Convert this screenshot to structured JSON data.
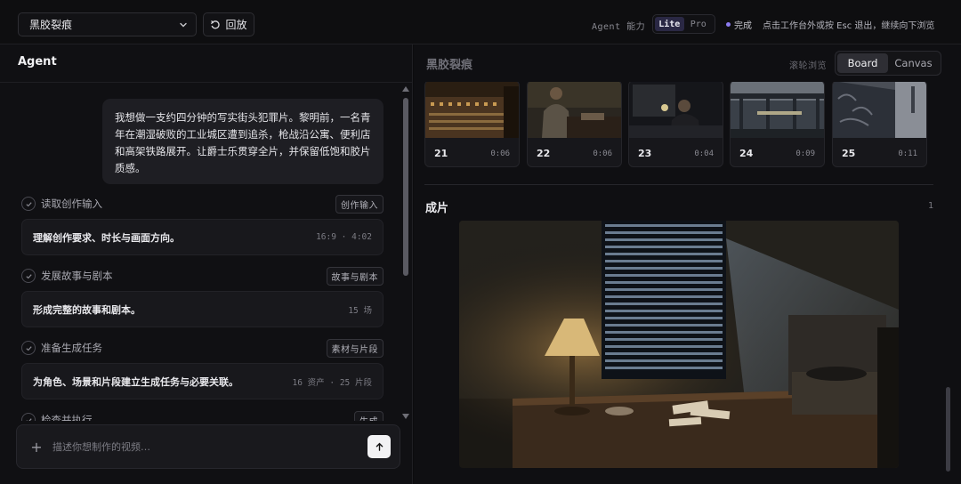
{
  "topbar": {
    "project": "黑胶裂痕",
    "replay_label": "回放",
    "agent_capability_label": "Agent 能力",
    "modes": [
      "Lite",
      "Pro"
    ],
    "active_mode": "Lite",
    "status_text": "完成",
    "hint_text": "点击工作台外或按 Esc 退出，继续向下浏览"
  },
  "agent_panel": {
    "title": "Agent",
    "user_message": "我想做一支约四分钟的写实街头犯罪片。黎明前，一名青年在潮湿破败的工业城区遭到追杀，枪战沿公寓、便利店和高架铁路展开。让爵士乐贯穿全片，并保留低饱和胶片质感。",
    "steps": [
      {
        "title": "读取创作输入",
        "tag": "创作输入",
        "desc": "理解创作要求、时长与画面方向。",
        "meta": "16:9 · 4:02"
      },
      {
        "title": "发展故事与剧本",
        "tag": "故事与剧本",
        "desc": "形成完整的故事和剧本。",
        "meta": "15 场"
      },
      {
        "title": "准备生成任务",
        "tag": "素材与片段",
        "desc": "为角色、场景和片段建立生成任务与必要关联。",
        "meta": "16 资产 · 25 片段"
      },
      {
        "title": "检查并执行",
        "tag": "生成",
        "desc": "",
        "meta": ""
      }
    ],
    "composer": {
      "placeholder": "描述你想制作的视频…"
    }
  },
  "workspace": {
    "title": "黑胶裂痕",
    "scroll_browse_label": "滚轮浏览",
    "views": [
      "Board",
      "Canvas"
    ],
    "active_view": "Board",
    "shots": [
      {
        "number": "21",
        "duration": "0:06",
        "thumb": "mixing-console"
      },
      {
        "number": "22",
        "duration": "0:06",
        "thumb": "man-at-desk"
      },
      {
        "number": "23",
        "duration": "0:04",
        "thumb": "man-dark-room"
      },
      {
        "number": "24",
        "duration": "0:09",
        "thumb": "elevated-rail"
      },
      {
        "number": "25",
        "duration": "0:11",
        "thumb": "graffiti-alley"
      }
    ],
    "final_section": {
      "title": "成片",
      "count": "1"
    }
  },
  "colors": {
    "accent": "#8c7cf0",
    "background": "#0c0c0e",
    "panel": "#101013",
    "card": "#18181c"
  }
}
